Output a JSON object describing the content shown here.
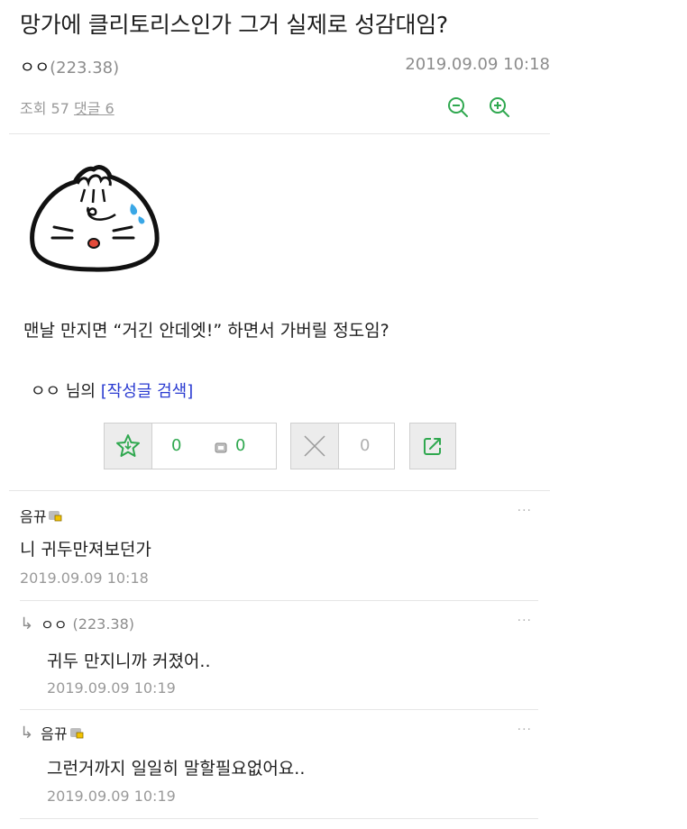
{
  "post": {
    "title": "망가에 클리토리스인가 그거 실제로 성감대임?",
    "author": "ㅇㅇ",
    "author_ip": "(223.38)",
    "date": "2019.09.09 10:18",
    "views_label": "조회 57",
    "comment_count_label": "댓글 6",
    "body": "맨날 만지면 “거긴 안데엣!” 하면서 가버릴 정도임?",
    "search_prefix": "ㅇㅇ 님의",
    "search_link": "[작성글 검색]",
    "zoom_out_icon": "zoom-out-icon",
    "zoom_in_icon": "zoom-in-icon",
    "accent_color": "#2fa84f"
  },
  "votes": {
    "recommend_count": "0",
    "fixed_recommend_count": "0",
    "not_recommend_count": "0",
    "recommend_icon": "star-icon",
    "not_recommend_icon": "x-icon",
    "share_icon": "share-icon"
  },
  "comments": [
    {
      "nick": "음뀨",
      "text": "니 귀두만져보던가",
      "date": "2019.09.09 10:18",
      "more": "···"
    },
    {
      "nick": "ㅇㅇ",
      "ip": "(223.38)",
      "text": "귀두 만지니까 커졌어..",
      "date": "2019.09.09 10:19",
      "more": "···",
      "reply_icon": "reply-arrow-icon"
    },
    {
      "nick": "음뀨",
      "text": "그런거까지 일일히 말할필요없어요..",
      "date": "2019.09.09 10:19",
      "more": "···",
      "reply_icon": "reply-arrow-icon"
    }
  ]
}
